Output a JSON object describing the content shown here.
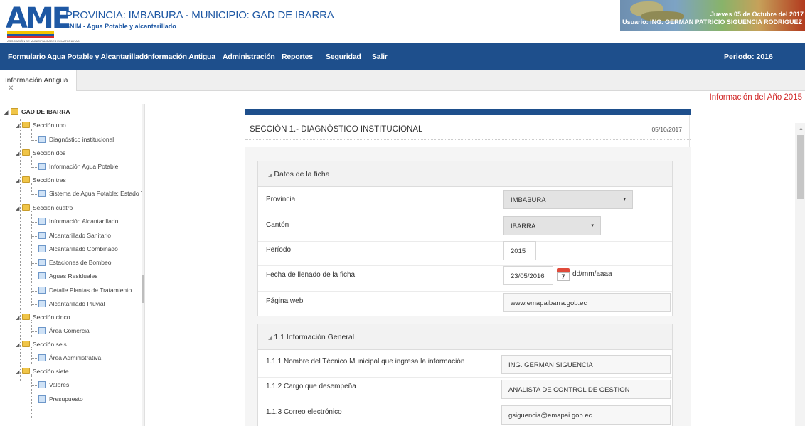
{
  "header": {
    "logo_text": "AME",
    "logo_caption": "ASOCIACIÓN DE MUNICIPALIDADES ECUATORIANAS",
    "title": "PROVINCIA: IMBABURA - MUNICIPIO: GAD DE IBARRA",
    "subtitle": "SNIM - Agua Potable y alcantarillado",
    "date_text": "Jueves 05 de Octubre del 2017",
    "user_text": "Usuario: ING. GERMAN PATRICIO SIGUENCIA RODRIGUEZ"
  },
  "nav": {
    "items": [
      "Formulario Agua Potable y Alcantarillado",
      "Información Antigua",
      "Administración",
      "Reportes",
      "Seguridad",
      "Salir"
    ],
    "period": "Periodo: 2016"
  },
  "tabs": {
    "active_label": "Información Antigua",
    "close_glyph": "✕"
  },
  "year_info": "Información del Año 2015",
  "tree": {
    "root": "GAD DE IBARRA",
    "nodes": [
      "Sección uno",
      "Diagnóstico institucional",
      "Sección dos",
      "Información Agua Potable",
      "Sección tres",
      "Sistema de Agua Potable: Estado Técn",
      "Sección cuatro",
      "Información Alcantarillado",
      "Alcantarillado Sanitario",
      "Alcantarillado Combinado",
      "Estaciones de Bombeo",
      "Aguas Residuales",
      "Detalle Plantas de Tratamiento",
      "Alcantarillado Pluvial",
      "Sección cinco",
      "Área Comercial",
      "Sección seis",
      "Área Administrativa",
      "Sección siete",
      "Valores",
      "Presupuesto"
    ]
  },
  "card": {
    "title": "SECCIÓN 1.- DIAGNÓSTICO INSTITUCIONAL",
    "date": "05/10/2017"
  },
  "ficha": {
    "heading": "Datos de la ficha",
    "provincia_label": "Provincia",
    "provincia_value": "IMBABURA",
    "canton_label": "Cantón",
    "canton_value": "IBARRA",
    "periodo_label": "Período",
    "periodo_value": "2015",
    "fecha_label": "Fecha de llenado de la ficha",
    "fecha_value": "23/05/2016",
    "fecha_hint": "dd/mm/aaaa",
    "calendar_day": "7",
    "web_label": "Página web",
    "web_value": "www.emapaibarra.gob.ec"
  },
  "general": {
    "heading": "1.1 Información General",
    "tecnico_label": "1.1.1 Nombre del Técnico Municipal que ingresa la información",
    "tecnico_value": "ING. GERMAN SIGUENCIA",
    "cargo_label": "1.1.2 Cargo que desempeña",
    "cargo_value": "ANALISTA DE CONTROL DE GESTION",
    "correo_label": "1.1.3 Correo electrónico",
    "correo_value": "gsiguencia@emapai.gob.ec"
  },
  "icons": {
    "caret": "▾",
    "collapse": "◢",
    "expand": "▲"
  }
}
